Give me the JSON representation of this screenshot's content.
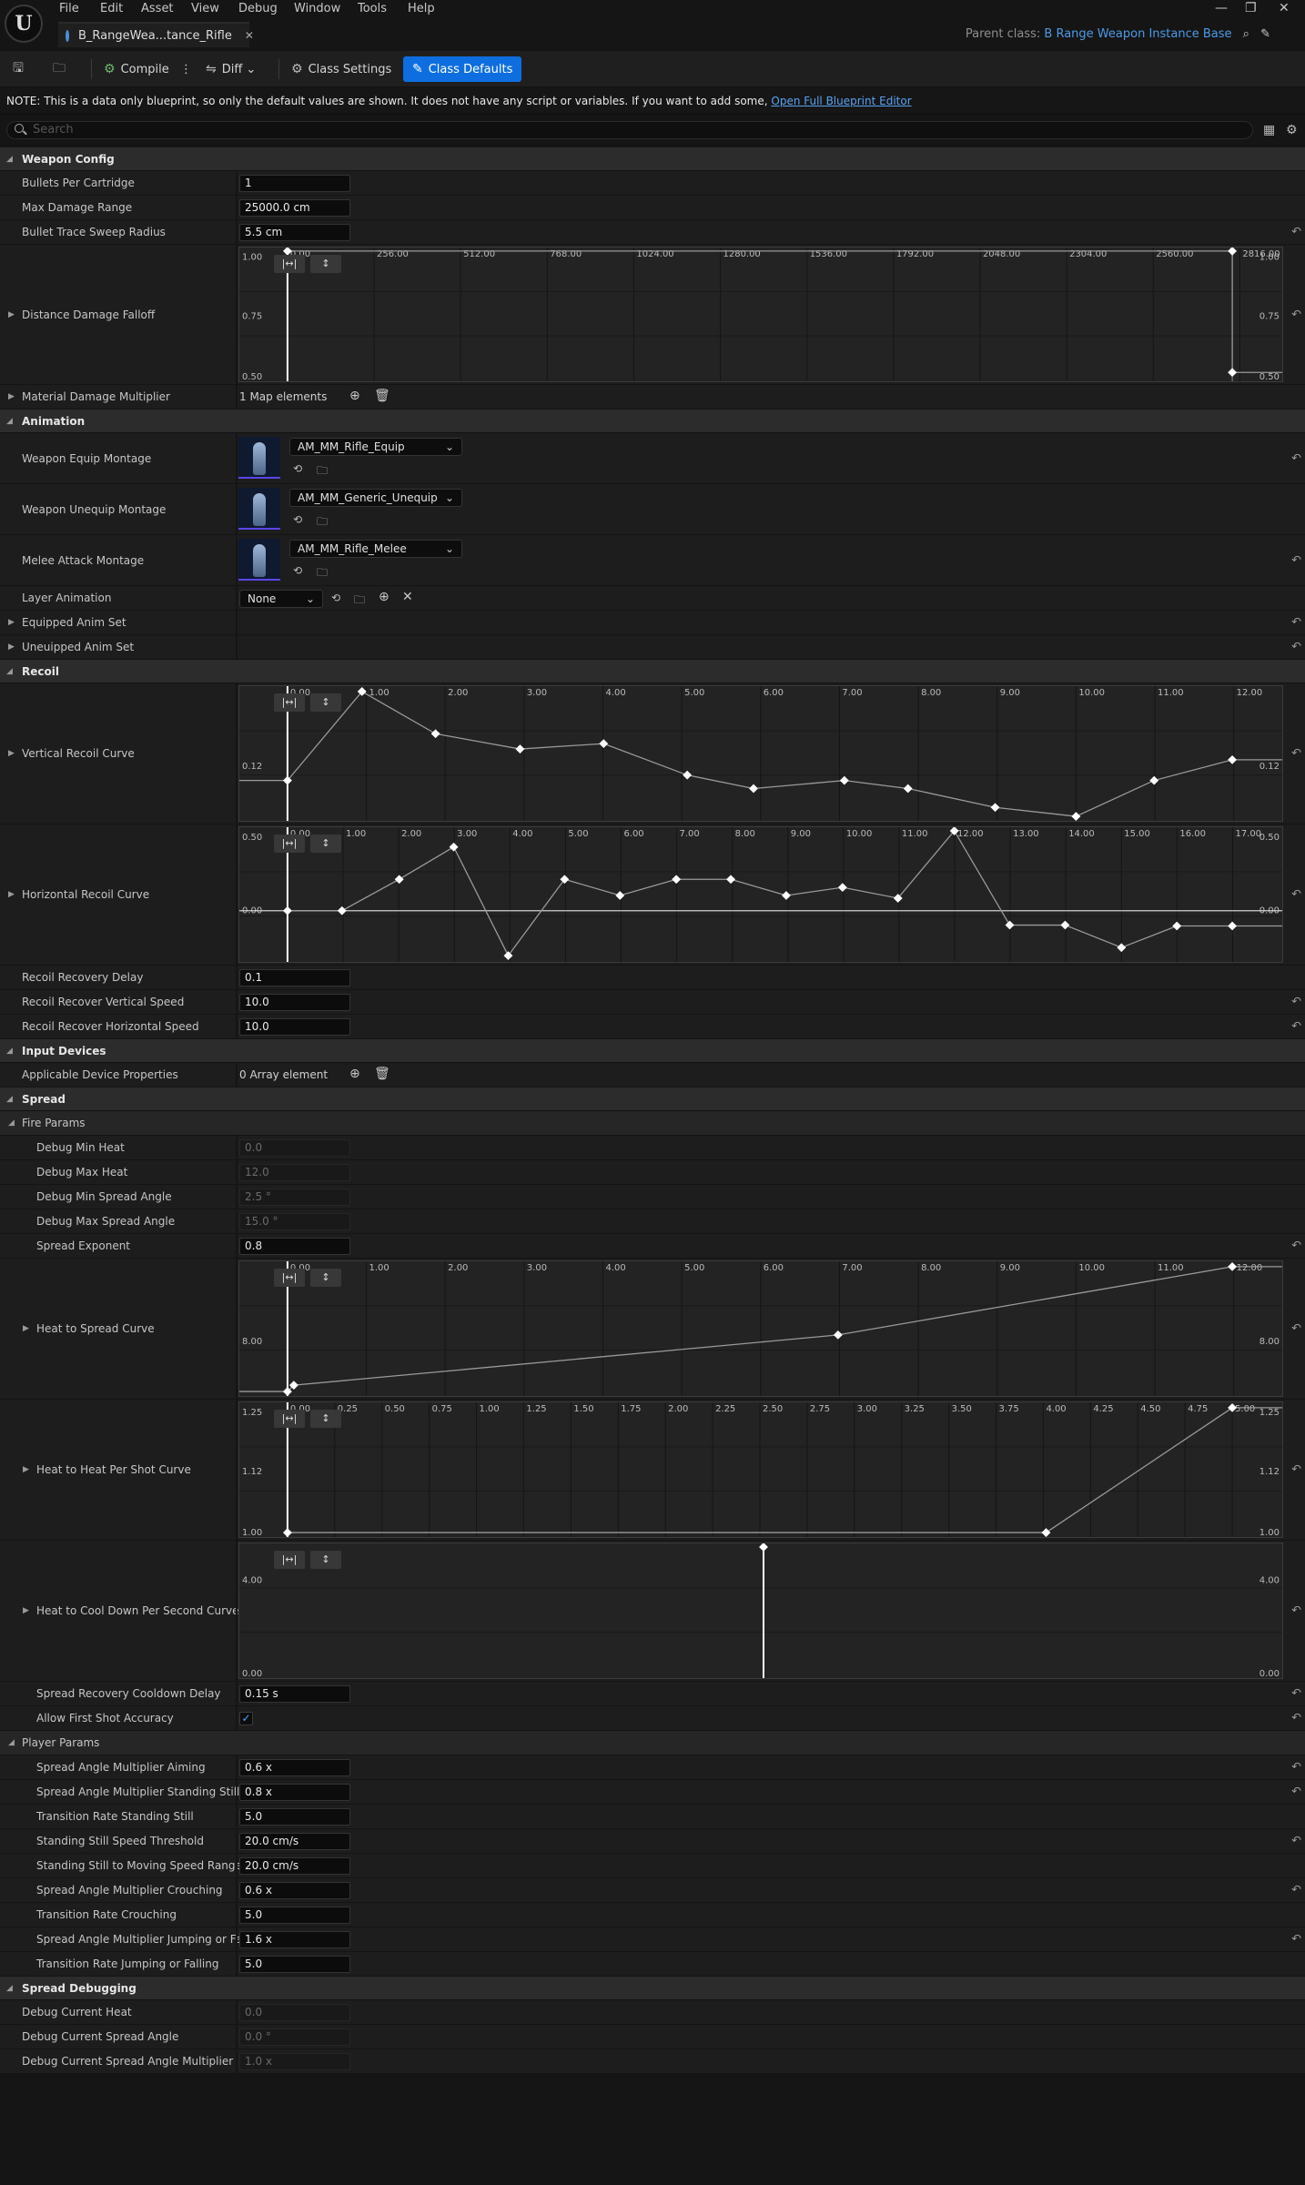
{
  "menu": [
    "File",
    "Edit",
    "Asset",
    "View",
    "Debug",
    "Window",
    "Tools",
    "Help"
  ],
  "tab": {
    "title": "B_RangeWea...tance_Rifle"
  },
  "parent_class": {
    "label": "Parent class:",
    "value": "B Range Weapon Instance Base"
  },
  "toolbar": {
    "compile": "Compile",
    "diff": "Diff",
    "class_settings": "Class Settings",
    "class_defaults": "Class Defaults"
  },
  "note": {
    "text": "NOTE: This is a data only blueprint, so only the default values are shown.  It does not have any script or variables.  If you want to add some,",
    "link": "Open Full Blueprint Editor"
  },
  "search": {
    "placeholder": "Search"
  },
  "weapon_config": {
    "title": "Weapon Config",
    "bullets_label": "Bullets Per Cartridge",
    "bullets": "1",
    "max_range_label": "Max Damage Range",
    "max_range": "25000.0 cm",
    "sweep_label": "Bullet Trace Sweep Radius",
    "sweep": "5.5 cm",
    "falloff_label": "Distance Damage Falloff",
    "material_label": "Material Damage Multiplier",
    "material": "1 Map elements"
  },
  "animation": {
    "title": "Animation",
    "equip_label": "Weapon Equip Montage",
    "equip": "AM_MM_Rifle_Equip",
    "unequip_label": "Weapon Unequip Montage",
    "unequip": "AM_MM_Generic_Unequip",
    "melee_label": "Melee Attack Montage",
    "melee": "AM_MM_Rifle_Melee",
    "layer_label": "Layer Animation",
    "layer": "None",
    "equipped_label": "Equipped Anim Set",
    "unequipped_label": "Uneuipped Anim Set"
  },
  "recoil": {
    "title": "Recoil",
    "vertical_label": "Vertical Recoil Curve",
    "horizontal_label": "Horizontal Recoil Curve",
    "delay_label": "Recoil Recovery Delay",
    "delay": "0.1",
    "vspeed_label": "Recoil Recover Vertical Speed",
    "vspeed": "10.0",
    "hspeed_label": "Recoil Recover Horizontal Speed",
    "hspeed": "10.0"
  },
  "input_devices": {
    "title": "Input Devices",
    "props_label": "Applicable Device Properties",
    "props": "0 Array element"
  },
  "spread": {
    "title": "Spread",
    "fire_params": "Fire Params",
    "min_heat_label": "Debug Min Heat",
    "min_heat": "0.0",
    "max_heat_label": "Debug Max Heat",
    "max_heat": "12.0",
    "min_angle_label": "Debug Min Spread Angle",
    "min_angle": "2.5 °",
    "max_angle_label": "Debug Max Spread Angle",
    "max_angle": "15.0 °",
    "exponent_label": "Spread Exponent",
    "exponent": "0.8",
    "heat_spread_label": "Heat to Spread Curve",
    "heat_shot_label": "Heat to Heat Per Shot Curve",
    "heat_cool_label": "Heat to Cool Down Per Second Curve",
    "cooldown_label": "Spread Recovery Cooldown Delay",
    "cooldown": "0.15 s",
    "first_shot_label": "Allow First Shot Accuracy",
    "player_params": "Player Params",
    "aiming_label": "Spread Angle Multiplier Aiming",
    "aiming": "0.6 x",
    "standing_label": "Spread Angle Multiplier Standing Still",
    "standing": "0.8 x",
    "tr_standing_label": "Transition Rate Standing Still",
    "tr_standing": "5.0",
    "still_thresh_label": "Standing Still Speed Threshold",
    "still_thresh": "20.0 cm/s",
    "still_moving_label": "Standing Still to Moving Speed Range",
    "still_moving": "20.0 cm/s",
    "crouch_label": "Spread Angle Multiplier Crouching",
    "crouch": "0.6 x",
    "tr_crouch_label": "Transition Rate Crouching",
    "tr_crouch": "5.0",
    "jump_label": "Spread Angle Multiplier Jumping or Falli...",
    "jump": "1.6 x",
    "tr_jump_label": "Transition Rate Jumping or Falling",
    "tr_jump": "5.0"
  },
  "spread_debugging": {
    "title": "Spread Debugging",
    "heat_label": "Debug Current Heat",
    "heat": "0.0",
    "angle_label": "Debug Current Spread Angle",
    "angle": "0.0 °",
    "mult_label": "Debug Current Spread Angle Multiplier",
    "mult": "1.0 x"
  },
  "curves": {
    "falloff": {
      "xticks": [
        "0.00",
        "256.00",
        "512.00",
        "768.00",
        "1024.00",
        "1280.00",
        "1536.00",
        "1792.00",
        "2048.00",
        "2304.00",
        "2560.00",
        "2816.00"
      ],
      "ylabels": [
        "1.00",
        "0.75",
        "0.50"
      ],
      "ylabels_right": [
        "1.00",
        "0.75",
        "0.50"
      ]
    },
    "vertical": {
      "xticks": [
        "0.00",
        "1.00",
        "2.00",
        "3.00",
        "4.00",
        "5.00",
        "6.00",
        "7.00",
        "8.00",
        "9.00",
        "10.00",
        "11.00",
        "12.00"
      ],
      "ylabels": [
        "0.12"
      ],
      "ylabels_right": [
        "0.12"
      ]
    },
    "horizontal": {
      "xticks": [
        "0.00",
        "1.00",
        "2.00",
        "3.00",
        "4.00",
        "5.00",
        "6.00",
        "7.00",
        "8.00",
        "9.00",
        "10.00",
        "11.00",
        "12.00",
        "13.00",
        "14.00",
        "15.00",
        "16.00",
        "17.00"
      ],
      "ylabels": [
        "0.50",
        "0.00"
      ],
      "ylabels_right": [
        "0.50",
        "0.00"
      ]
    },
    "heat_spread": {
      "xticks": [
        "0.00",
        "1.00",
        "2.00",
        "3.00",
        "4.00",
        "5.00",
        "6.00",
        "7.00",
        "8.00",
        "9.00",
        "10.00",
        "11.00",
        "12.00"
      ],
      "ylabels": [
        "8.00"
      ],
      "ylabels_right": [
        "8.00"
      ]
    },
    "heat_shot": {
      "xticks": [
        "0.00",
        "0.25",
        "0.50",
        "0.75",
        "1.00",
        "1.25",
        "1.50",
        "1.75",
        "2.00",
        "2.25",
        "2.50",
        "2.75",
        "3.00",
        "3.25",
        "3.50",
        "3.75",
        "4.00",
        "4.25",
        "4.50",
        "4.75",
        "5.00"
      ],
      "ylabels": [
        "1.25",
        "1.12",
        "1.00"
      ],
      "ylabels_right": [
        "1.25",
        "1.12",
        "1.00"
      ]
    },
    "heat_cool": {
      "xticks": [],
      "ylabels": [
        "4.00",
        "0.00"
      ],
      "ylabels_right": [
        "4.00",
        "0.00"
      ]
    }
  }
}
